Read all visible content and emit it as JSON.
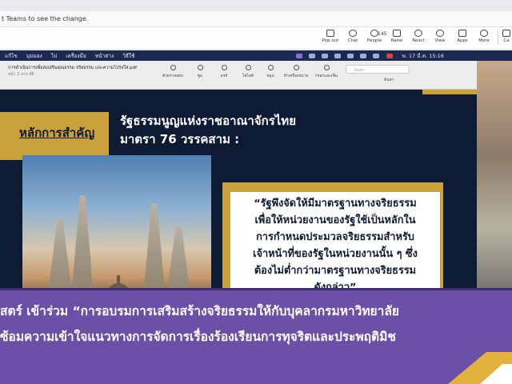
{
  "teams": {
    "notice": "t Teams to see the change.",
    "toolbar": [
      {
        "label": "Pop out",
        "icon": "pop-out-icon"
      },
      {
        "label": "Chat",
        "icon": "chat-icon"
      },
      {
        "label": "People",
        "icon": "people-icon",
        "count": "145"
      },
      {
        "label": "Raise",
        "icon": "raise-hand-icon"
      },
      {
        "label": "React",
        "icon": "react-icon"
      },
      {
        "label": "View",
        "icon": "view-icon"
      },
      {
        "label": "Apps",
        "icon": "apps-icon"
      },
      {
        "label": "More",
        "icon": "more-icon"
      },
      {
        "label": "Ca",
        "icon": "camera-icon"
      }
    ]
  },
  "mac": {
    "menu": [
      "แก้ไข",
      "มุมมอง",
      "ไป",
      "เครื่องมือ",
      "หน้าต่าง",
      "วิธีใช้"
    ],
    "clock": "พ. 17 มี.ค. 15:16"
  },
  "pdf": {
    "title": "การดำเนินการเพื่อส่งเสริมคุณธรรม จริยธรรม และความโปร่งใส.pdf",
    "pages": "หน้า 2 จาก 48",
    "tools": [
      {
        "label": "ตัวตรวจสอบ",
        "icon": "inspector-icon"
      },
      {
        "label": "ซูม",
        "icon": "zoom-icon"
      },
      {
        "label": "แชร์",
        "icon": "share-icon"
      },
      {
        "label": "ไฮไลท์",
        "icon": "highlight-icon"
      },
      {
        "label": "หมุน",
        "icon": "rotate-icon"
      },
      {
        "label": "ทำเครื่องหมาย",
        "icon": "markup-icon"
      },
      {
        "label": "กรอกและเซ็น",
        "icon": "fill-sign-icon"
      }
    ],
    "search_placeholder": "ค้นหา",
    "search_label": "ค้นหา"
  },
  "slide": {
    "header": "หลักการสำคัญ",
    "title_line1": "รัฐธรรมนูญแห่งราชอาณาจักรไทย",
    "title_line2": "มาตรา 76 วรรคสาม :",
    "quote": "“รัฐพึงจัดให้มีมาตรฐานทางจริยธรรม\nเพื่อให้หน่วยงานของรัฐใช้เป็นหลักใน\nการกำหนดประมวลจริยธรรมสำหรับ\nเจ้าหน้าที่ของรัฐในหน่วยงานนั้น ๆ ซึ่ง\nต้องไม่ต่ำกว่ามาตรฐานทางจริยธรรม\nดังกล่าว”"
  },
  "banner": {
    "line1": "สตร์ เข้าร่วม “การอบรมการเสริมสร้างจริยธรรมให้กับบุคลากรมหาวิทยาลัย",
    "line2": "ซ้อมความเข้าใจแนวทางการจัดการเรื่องร้องเรียนการทุจริตและประพฤติมิช"
  },
  "colors": {
    "slide_bg": "#0e1b34",
    "gold": "#c9a13b",
    "banner": "#6c4fa7"
  }
}
